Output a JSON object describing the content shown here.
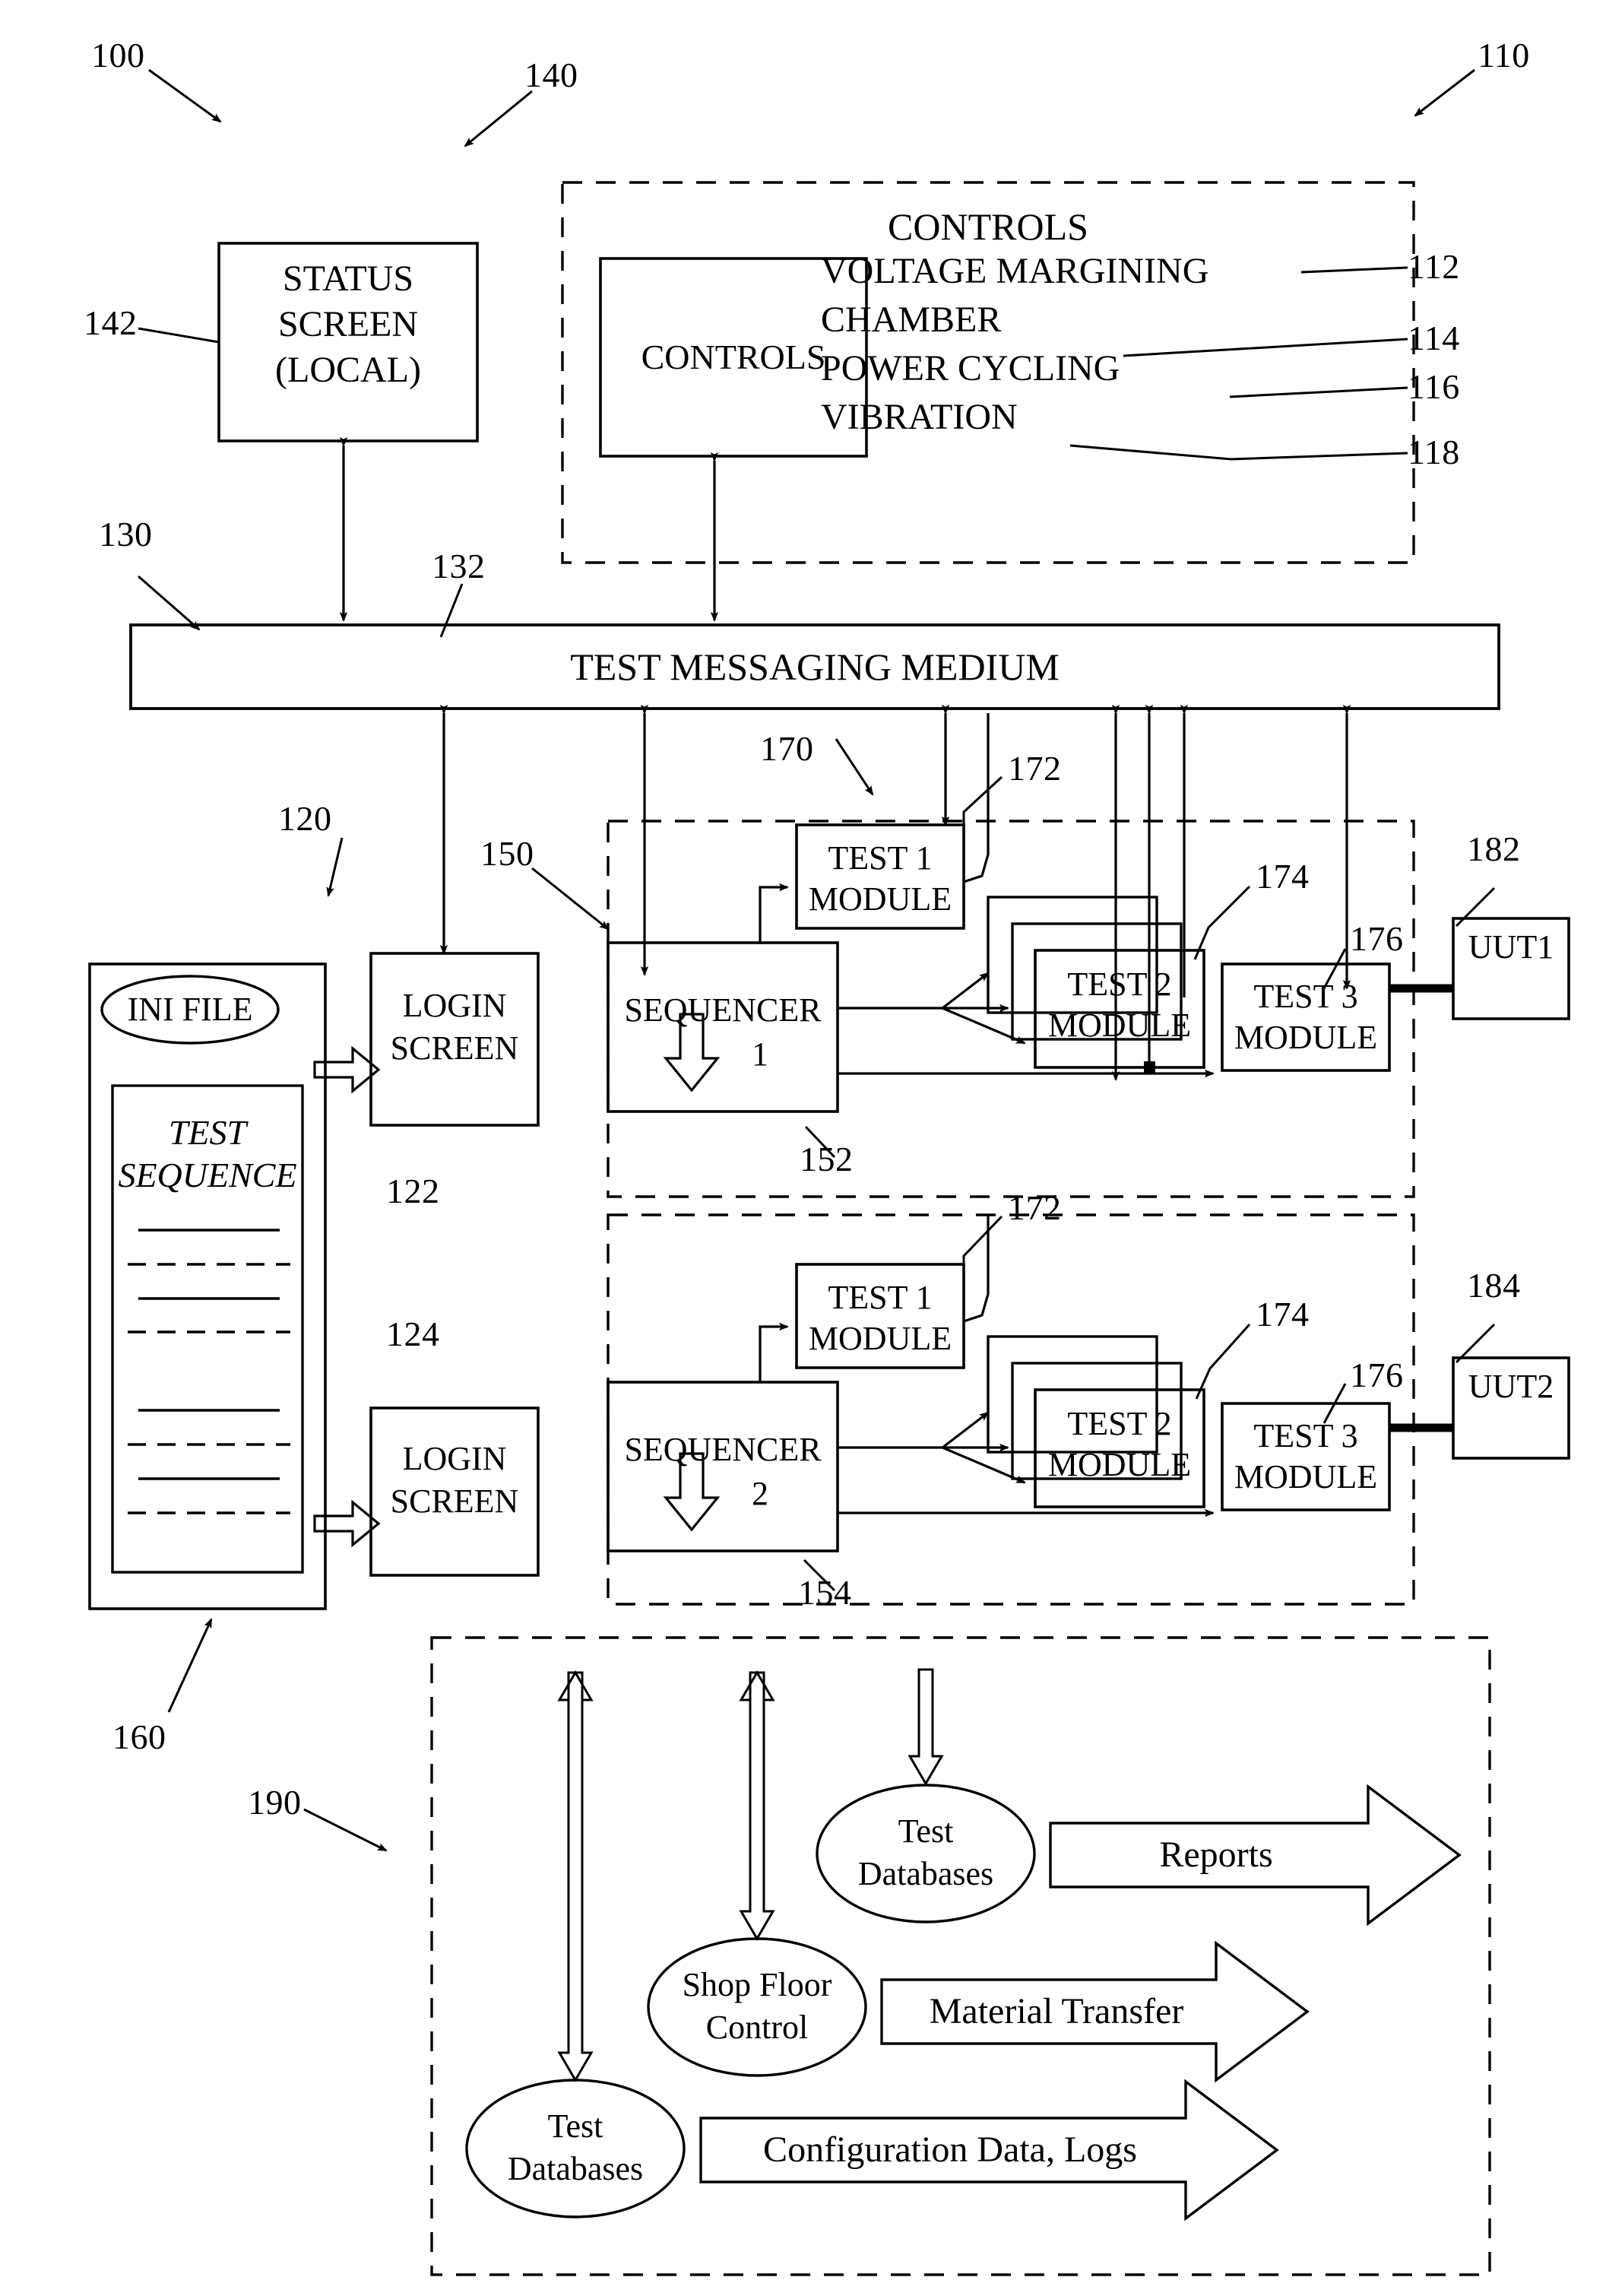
{
  "figure": {
    "type": "patent-block-diagram",
    "system_ref": "100"
  },
  "controls_group": {
    "ref": "110",
    "title": "CONTROLS",
    "inner_box_label": "CONTROLS",
    "items": [
      {
        "label": "VOLTAGE MARGINING",
        "ref": "112"
      },
      {
        "label": "CHAMBER",
        "ref": "114"
      },
      {
        "label": "POWER CYCLING",
        "ref": "116"
      },
      {
        "label": "VIBRATION",
        "ref": "118"
      }
    ]
  },
  "status_screen": {
    "ref_group": "140",
    "ref_box": "142",
    "line1": "STATUS",
    "line2": "SCREEN",
    "line3": "(LOCAL)"
  },
  "messaging": {
    "ref_group": "130",
    "ref_bar": "132",
    "label": "TEST MESSAGING MEDIUM"
  },
  "login_group": {
    "ref": "120",
    "screens": [
      {
        "line1": "LOGIN",
        "line2": "SCREEN",
        "ref": "122"
      },
      {
        "line1": "LOGIN",
        "line2": "SCREEN",
        "ref": "124"
      }
    ]
  },
  "ini_file": {
    "ref": "160",
    "oval_label": "INI FILE",
    "sequence_line1": "TEST",
    "sequence_line2": "SEQUENCE"
  },
  "test_station_group": {
    "ref": "150",
    "stations": [
      {
        "sequencer": {
          "line1": "SEQUENCER",
          "line2": "1",
          "ref": "152"
        },
        "modules": [
          {
            "line1": "TEST 1",
            "line2": "MODULE",
            "ref": "172",
            "group_ref": "170"
          },
          {
            "line1": "TEST 2",
            "line2": "MODULE",
            "ref": "174"
          },
          {
            "line1": "TEST 3",
            "line2": "MODULE",
            "ref": "176"
          }
        ],
        "uut": {
          "label": "UUT1",
          "ref": "182"
        }
      },
      {
        "sequencer": {
          "line1": "SEQUENCER",
          "line2": "2",
          "ref": "154"
        },
        "modules": [
          {
            "line1": "TEST 1",
            "line2": "MODULE",
            "ref": "172"
          },
          {
            "line1": "TEST 2",
            "line2": "MODULE",
            "ref": "174"
          },
          {
            "line1": "TEST 3",
            "line2": "MODULE",
            "ref": "176"
          }
        ],
        "uut": {
          "label": "UUT2",
          "ref": "184"
        }
      }
    ]
  },
  "external_group": {
    "ref": "190",
    "nodes": [
      {
        "line1": "Test",
        "line2": "Databases"
      },
      {
        "line1": "Shop Floor",
        "line2": "Control"
      },
      {
        "line1": "Test",
        "line2": "Databases"
      }
    ],
    "arrows": [
      {
        "label": "Reports"
      },
      {
        "label": "Material Transfer"
      },
      {
        "label": "Configuration Data, Logs"
      }
    ]
  },
  "colors": {
    "ink": "#000000",
    "paper": "#ffffff"
  }
}
